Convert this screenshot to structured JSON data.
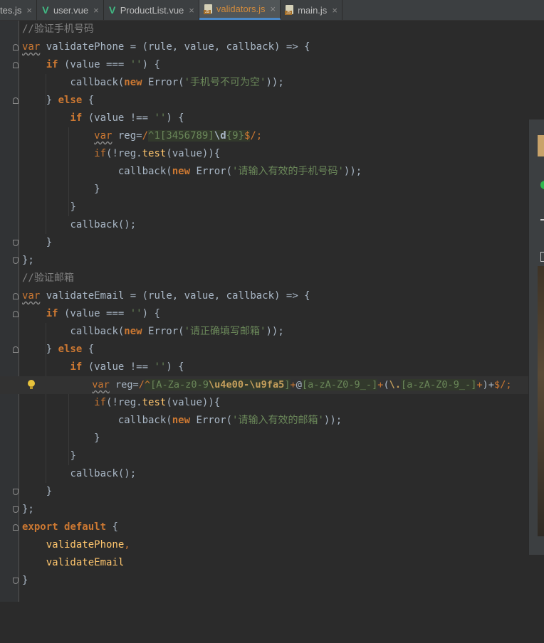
{
  "tabs": [
    {
      "label": "tes.js",
      "icon": "none",
      "active": false
    },
    {
      "label": "user.vue",
      "icon": "vue-icon",
      "active": false
    },
    {
      "label": "ProductList.vue",
      "icon": "vue-icon",
      "active": false
    },
    {
      "label": "validators.js",
      "icon": "js-file-icon",
      "active": true
    },
    {
      "label": "main.js",
      "icon": "js-file-icon",
      "active": false
    }
  ],
  "tab_icon_text": {
    "vue": "V",
    "js": "JS",
    "close": "×"
  },
  "colors": {
    "keyword": "#cc7832",
    "comment": "#808080",
    "string": "#6a8759",
    "function": "#ffc66d",
    "text": "#a9b7c6",
    "background": "#2b2b2b",
    "active_tab_label": "#d08a3c"
  },
  "code": {
    "l1": {
      "comment": "//验证手机号码"
    },
    "l2": {
      "kw": "var",
      "name": "validatePhone",
      "rest": " = (rule, value, callback) => {"
    },
    "l3": {
      "kw": "if",
      "rest1": " (value === ",
      "str": "''",
      "rest2": ") {"
    },
    "l4": {
      "call": "callback(",
      "kw": "new",
      "err": " Error(",
      "str": "'手机号不可为空'",
      "end": "));"
    },
    "l5": {
      "open": "} ",
      "kw": "else",
      "rest": " {"
    },
    "l6": {
      "kw": "if",
      "rest1": " (value !== ",
      "str": "''",
      "rest2": ") {"
    },
    "l7": {
      "kw": "var",
      "decl": " reg=",
      "slash": "/",
      "caret": "^",
      "one": "1",
      "bracket": "[3456789]",
      "d": "\\d",
      "quant": "{9}",
      "dollar": "$",
      "end": "/;"
    },
    "l8": {
      "kw": "if",
      "pre": "(!reg.",
      "method": "test",
      "post": "(value)){"
    },
    "l9": {
      "call": "callback(",
      "kw": "new",
      "err": " Error(",
      "str": "'请输入有效的手机号码'",
      "end": "));"
    },
    "l10": {
      "text": "}"
    },
    "l11": {
      "text": "}"
    },
    "l12": {
      "text": "callback();"
    },
    "l13": {
      "text": "}"
    },
    "l14": {
      "text": "};"
    },
    "l15": {
      "comment": "//验证邮箱"
    },
    "l16": {
      "kw": "var",
      "name": "validateEmail",
      "rest": " = (rule, value, callback) => {"
    },
    "l17": {
      "kw": "if",
      "rest1": " (value === ",
      "str": "''",
      "rest2": ") {"
    },
    "l18": {
      "call": "callback(",
      "kw": "new",
      "err": " Error(",
      "str": "'请正确填写邮箱'",
      "end": "));"
    },
    "l19": {
      "open": "} ",
      "kw": "else",
      "rest": " {"
    },
    "l20": {
      "kw": "if",
      "rest1": " (value !== ",
      "str": "''",
      "rest2": ") {"
    },
    "l21": {
      "kw": "var",
      "decl": " reg=",
      "slash": "/",
      "caret": "^",
      "c1": "[A-Za-z0-9",
      "u1": "\\u4e00-\\u9fa5",
      "c1e": "]",
      "plus1": "+",
      "at": "@",
      "c2": "[a-zA-Z0-9_-]",
      "plus2": "+",
      "grp": "(",
      "dot": "\\.",
      "c3": "[a-zA-Z0-9_-]",
      "plus3": "+",
      "grpe": ")+",
      "dollar": "$",
      "end": "/;"
    },
    "l22": {
      "kw": "if",
      "pre": "(!reg.",
      "method": "test",
      "post": "(value)){"
    },
    "l23": {
      "call": "callback(",
      "kw": "new",
      "err": " Error(",
      "str": "'请输入有效的邮箱'",
      "end": "));"
    },
    "l24": {
      "text": "}"
    },
    "l25": {
      "text": "}"
    },
    "l26": {
      "text": "callback();"
    },
    "l27": {
      "text": "}"
    },
    "l28": {
      "text": "};"
    },
    "l29": {
      "kw1": "export",
      "kw2": "default",
      "rest": " {"
    },
    "l30": {
      "name": "validatePhone",
      "rest": ","
    },
    "l31": {
      "name": "validateEmail"
    },
    "l32": {
      "text": "}"
    }
  }
}
